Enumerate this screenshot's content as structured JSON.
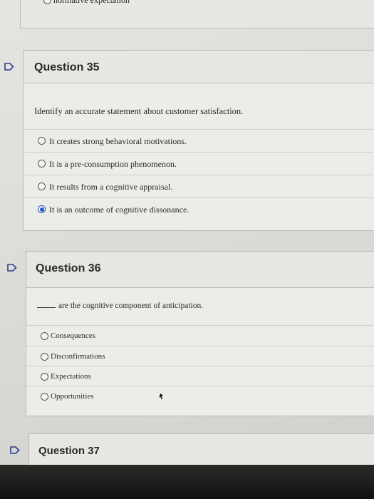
{
  "previous": {
    "option_label": "normative expectation"
  },
  "questions": [
    {
      "title": "Question 35",
      "stem": "Identify an accurate statement about customer satisfaction.",
      "options": [
        "It creates strong behavioral motivations.",
        "It is a pre-consumption phenomenon.",
        "It results from a cognitive appraisal.",
        "It is an outcome of cognitive dissonance."
      ],
      "selected_index": 3
    },
    {
      "title": "Question 36",
      "stem": "are the cognitive component of anticipation.",
      "options": [
        "Consequences",
        "Disconfirmations",
        "Expectations",
        "Opportunities"
      ],
      "selected_index": null
    },
    {
      "title": "Question 37"
    }
  ],
  "colors": {
    "flag": "#2c3e8c",
    "selected_radio": "#1f57c9",
    "card_background": "#ecece8"
  },
  "icons": [
    "flag-icon",
    "radio-button",
    "mouse-cursor-icon"
  ]
}
